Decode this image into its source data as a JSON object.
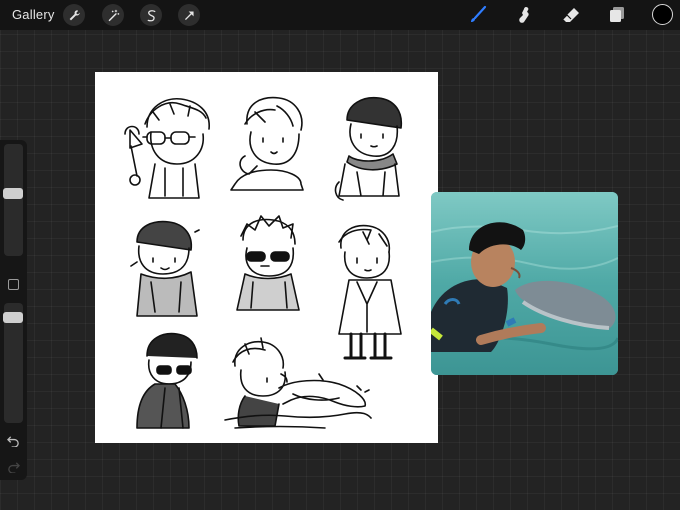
{
  "toolbar": {
    "gallery_label": "Gallery",
    "left_tools": [
      "wrench-icon",
      "magic-wand-icon",
      "selection-icon",
      "transform-arrow-icon"
    ],
    "right_tools": [
      "brush-icon",
      "smudge-icon",
      "eraser-icon",
      "layers-icon"
    ],
    "active_tool": "brush-icon",
    "accent_color": "#2f7dff",
    "current_color": "#000000"
  },
  "sidebar": {
    "brush_size_level": 0.37,
    "opacity_level": 0.2,
    "modify_button_icon": "square-icon",
    "undo_icon": "undo-icon",
    "redo_icon": "redo-icon"
  },
  "canvas": {
    "background": "#ffffff",
    "sketches": [
      "boy-with-glasses-and-ice-cream",
      "boy-hand-on-face",
      "boy-with-beanie-and-scarf",
      "boy-with-beanie-and-jacket",
      "boy-with-sunglasses",
      "boy-in-suit",
      "boy-with-sunglasses-and-coat",
      "boy-with-dolphin"
    ]
  },
  "reference_photo": {
    "subject": "boy-kissing-dolphin-photo",
    "water_color": "#4fa9a6"
  }
}
